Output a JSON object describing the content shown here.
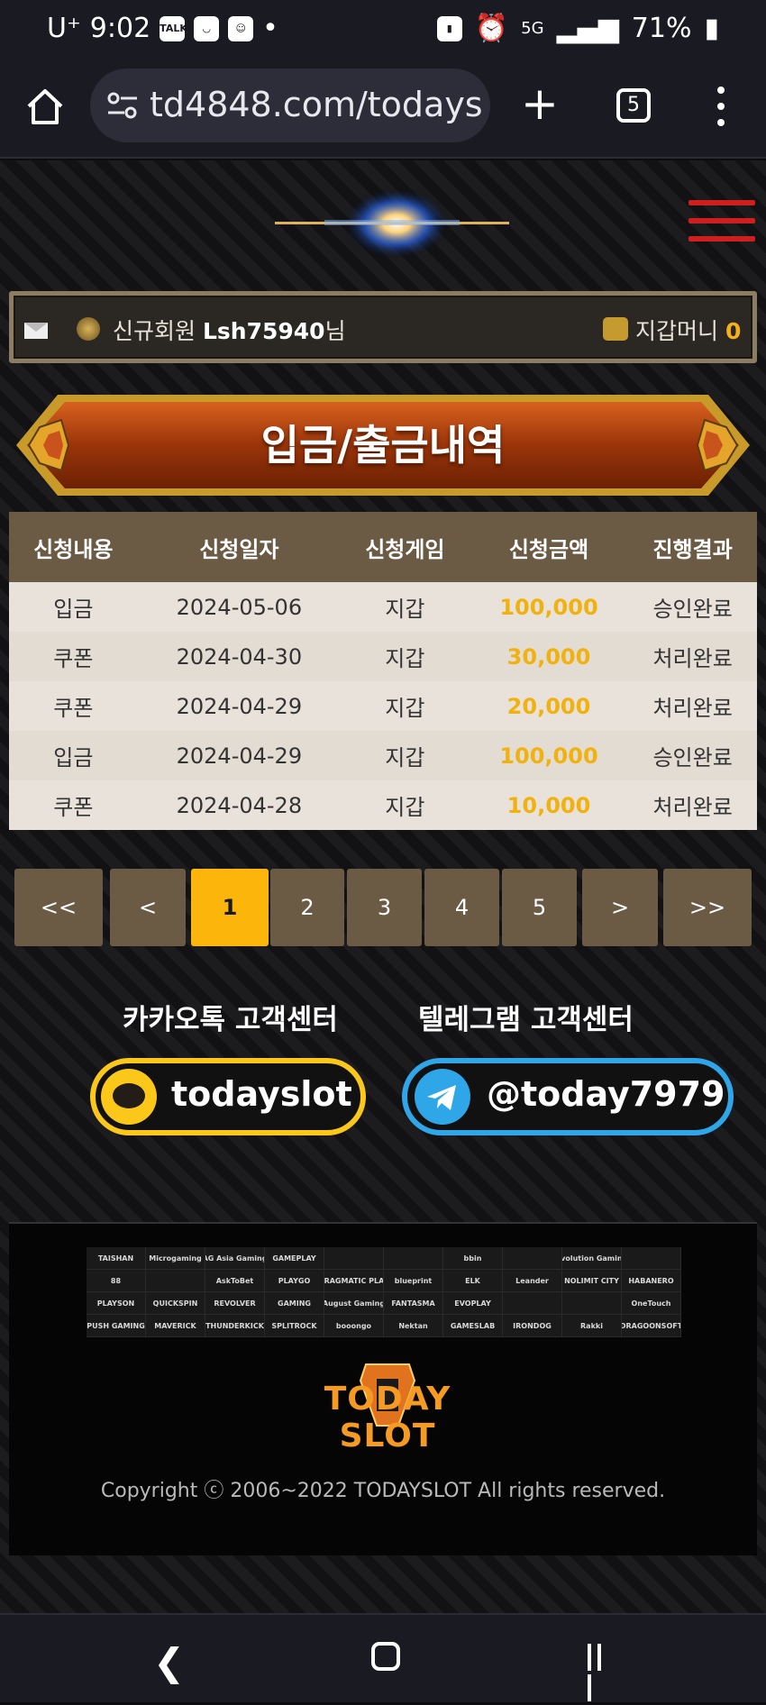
{
  "status": {
    "carrier": "U⁺",
    "time": "9:02",
    "battery": "71%",
    "network": "5G"
  },
  "browser": {
    "url": "td4848.com/todays",
    "tab_count": "5"
  },
  "user": {
    "level_label": "신규회원",
    "username": "Lsh75940",
    "suffix": "님",
    "wallet_label": "지갑머니",
    "wallet_value": "0"
  },
  "page": {
    "title": "입금/출금내역"
  },
  "table": {
    "headers": [
      "신청내용",
      "신청일자",
      "신청게임",
      "신청금액",
      "진행결과"
    ],
    "rows": [
      [
        "입금",
        "2024-05-06",
        "지갑",
        "100,000",
        "승인완료"
      ],
      [
        "쿠폰",
        "2024-04-30",
        "지갑",
        "30,000",
        "처리완료"
      ],
      [
        "쿠폰",
        "2024-04-29",
        "지갑",
        "20,000",
        "처리완료"
      ],
      [
        "입금",
        "2024-04-29",
        "지갑",
        "100,000",
        "승인완료"
      ],
      [
        "쿠폰",
        "2024-04-28",
        "지갑",
        "10,000",
        "처리완료"
      ]
    ]
  },
  "pagination": {
    "first": "<<",
    "prev": "<",
    "pages": [
      "1",
      "2",
      "3",
      "4",
      "5"
    ],
    "next": ">",
    "last": ">>",
    "active": "1"
  },
  "support": {
    "kakao_title": "카카오톡 고객센터",
    "kakao_id": "todayslot",
    "telegram_title": "텔레그램 고객센터",
    "telegram_id": "@today7979"
  },
  "footer": {
    "providers": [
      "TAISHAN",
      "Microgaming",
      "AG Asia Gaming",
      "GAMEPLAY",
      "",
      "",
      "bbin",
      "",
      "Evolution Gaming",
      "",
      "88",
      "",
      "AskToBet",
      "PLAYGO",
      "PRAGMATIC PLAY",
      "blueprint",
      "ELK",
      "Leander",
      "NOLIMIT CITY",
      "HABANERO",
      "PLAYSON",
      "QUICKSPIN",
      "REVOLVER",
      "GAMING",
      "August Gaming",
      "FANTASMA",
      "EVOPLAY",
      "",
      "",
      "OneTouch",
      "PUSH GAMING",
      "MAVERICK",
      "THUNDERKICK",
      "SPLITROCK",
      "booongo",
      "Nektan",
      "GAMESLAB",
      "IRONDOG",
      "Rakki",
      "DRAGOONSOFT"
    ],
    "brand": "TODAY SLOT",
    "copyright": "Copyright ⓒ 2006~2022 TODAYSLOT All rights reserved."
  },
  "colors": {
    "accent": "#fbb50b",
    "header_brown": "#6b5a44",
    "amount": "#f1b10e",
    "kakao": "#fbc81a",
    "telegram": "#2ea6e8",
    "menu_red": "#d01d1d"
  }
}
